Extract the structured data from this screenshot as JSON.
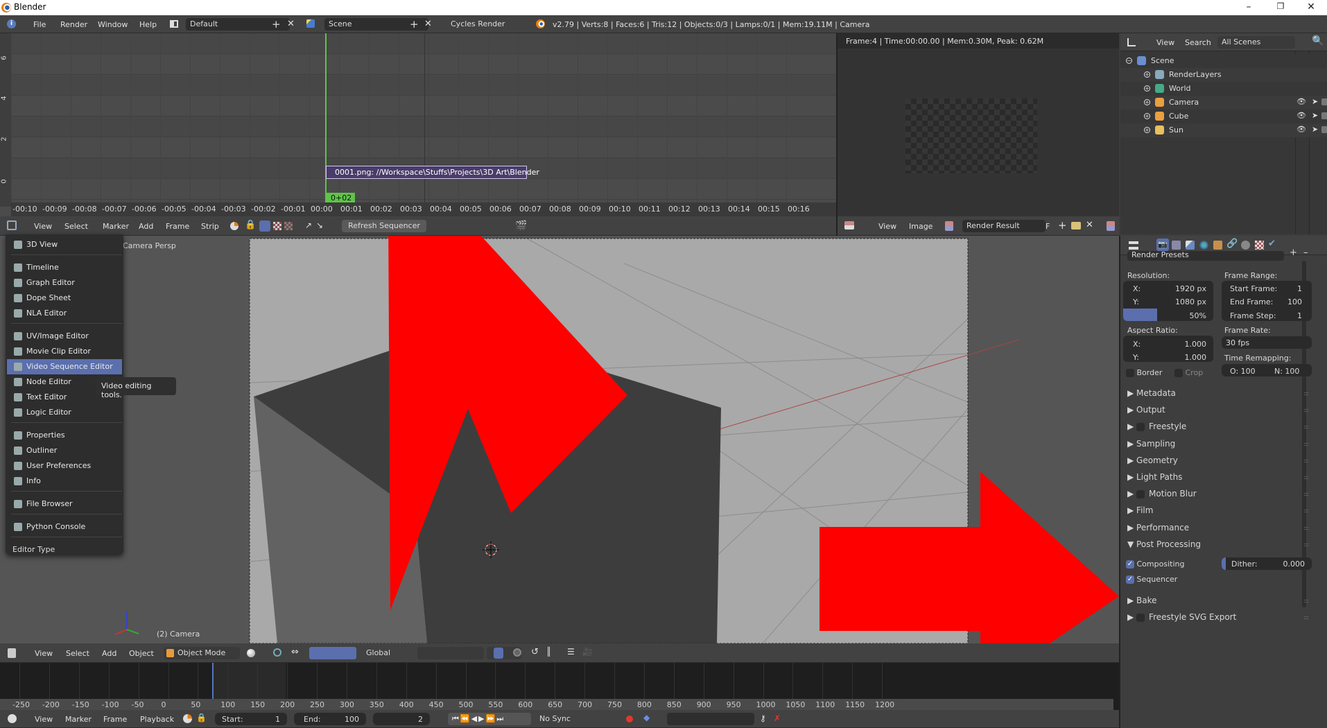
{
  "window": {
    "title": "Blender",
    "controls": [
      "minimize",
      "restore",
      "close"
    ]
  },
  "info_header": {
    "menus": [
      "File",
      "Render",
      "Window",
      "Help"
    ],
    "screen_layout": "Default",
    "scene": "Scene",
    "render_engine": "Cycles Render",
    "stats": "v2.79 | Verts:8 | Faces:6 | Tris:12 | Objects:0/3 | Lamps:0/1 | Mem:19.11M | Camera"
  },
  "sequencer": {
    "y_ticks": [
      "6",
      "4",
      "2",
      "0"
    ],
    "x_ticks": [
      "-00:10",
      "-00:09",
      "-00:08",
      "-00:07",
      "-00:06",
      "-00:05",
      "-00:04",
      "-00:03",
      "-00:02",
      "-00:01",
      "00:00",
      "00:01",
      "00:02",
      "00:03",
      "00:04",
      "00:05",
      "00:06",
      "00:07",
      "00:08",
      "00:09",
      "00:10",
      "00:11",
      "00:12",
      "00:13",
      "00:14",
      "00:15",
      "00:16"
    ],
    "strip_label": "0001.png: //Workspace\\Stuffs\\Projects\\3D Art\\Blender",
    "current_frame_label": "0+02",
    "header_menus": [
      "View",
      "Select",
      "Marker",
      "Add",
      "Frame",
      "Strip"
    ],
    "refresh_button": "Refresh Sequencer"
  },
  "image_editor": {
    "render_info": "Frame:4 | Time:00:00.00 | Mem:0.30M, Peak: 0.62M",
    "header_menus": [
      "View",
      "Image"
    ],
    "image_name": "Render Result",
    "fake_user": "F"
  },
  "outliner": {
    "header_menus": [
      "View",
      "Search"
    ],
    "display_mode": "All Scenes",
    "items": [
      {
        "label": "Scene",
        "icon": "scene-icon",
        "level": 0
      },
      {
        "label": "RenderLayers",
        "icon": "render-layers-icon",
        "level": 1
      },
      {
        "label": "World",
        "icon": "world-icon",
        "level": 1
      },
      {
        "label": "Camera",
        "icon": "camera-object-icon",
        "level": 1
      },
      {
        "label": "Cube",
        "icon": "mesh-icon",
        "level": 1
      },
      {
        "label": "Sun",
        "icon": "lamp-icon",
        "level": 1
      }
    ]
  },
  "editor_type_menu": {
    "title": "Editor Type",
    "groups": [
      [
        {
          "label": "3D View",
          "icon": "3d-view-icon"
        }
      ],
      [
        {
          "label": "Timeline",
          "icon": "timeline-icon"
        },
        {
          "label": "Graph Editor",
          "icon": "graph-editor-icon"
        },
        {
          "label": "Dope Sheet",
          "icon": "dope-sheet-icon"
        },
        {
          "label": "NLA Editor",
          "icon": "nla-editor-icon"
        }
      ],
      [
        {
          "label": "UV/Image Editor",
          "icon": "uv-image-editor-icon"
        },
        {
          "label": "Movie Clip Editor",
          "icon": "movie-clip-editor-icon"
        },
        {
          "label": "Video Sequence Editor",
          "icon": "video-sequence-editor-icon",
          "highlighted": true
        },
        {
          "label": "Node Editor",
          "icon": "node-editor-icon"
        },
        {
          "label": "Text Editor",
          "icon": "text-editor-icon"
        },
        {
          "label": "Logic Editor",
          "icon": "logic-editor-icon"
        }
      ],
      [
        {
          "label": "Properties",
          "icon": "properties-icon"
        },
        {
          "label": "Outliner",
          "icon": "outliner-icon"
        },
        {
          "label": "User Preferences",
          "icon": "user-preferences-icon"
        },
        {
          "label": "Info",
          "icon": "info-icon"
        }
      ],
      [
        {
          "label": "File Browser",
          "icon": "file-browser-icon"
        }
      ],
      [
        {
          "label": "Python Console",
          "icon": "python-console-icon"
        }
      ]
    ],
    "tooltip": "Video editing tools."
  },
  "viewport": {
    "view_label": "Camera Persp",
    "object_label": "(2) Camera",
    "header_menus": [
      "View",
      "Select",
      "Add",
      "Object"
    ],
    "mode": "Object Mode",
    "orientation": "Global"
  },
  "properties": {
    "presets": "Render Presets",
    "resolution": {
      "label": "Resolution:",
      "x_label": "X:",
      "x": "1920 px",
      "y_label": "Y:",
      "y": "1080 px",
      "percent": "50%",
      "percent_value": 0.5
    },
    "aspect": {
      "label": "Aspect Ratio:",
      "x_label": "X:",
      "x": "1.000",
      "y_label": "Y:",
      "y": "1.000"
    },
    "border": "Border",
    "crop": "Crop",
    "frame_range": {
      "label": "Frame Range:",
      "start_label": "Start Frame:",
      "start": "1",
      "end_label": "End Frame:",
      "end": "100",
      "step_label": "Frame Step:",
      "step": "1"
    },
    "frame_rate": {
      "label": "Frame Rate:",
      "value": "30 fps"
    },
    "time_remap": {
      "label": "Time Remapping:",
      "old": "O: 100",
      "new": "N: 100"
    },
    "sections": [
      {
        "label": "Metadata",
        "checkbox": false
      },
      {
        "label": "Output",
        "checkbox": false
      },
      {
        "label": "Freestyle",
        "checkbox": true
      },
      {
        "label": "Sampling",
        "checkbox": false
      },
      {
        "label": "Geometry",
        "checkbox": false
      },
      {
        "label": "Light Paths",
        "checkbox": false
      },
      {
        "label": "Motion Blur",
        "checkbox": true
      },
      {
        "label": "Film",
        "checkbox": false
      },
      {
        "label": "Performance",
        "checkbox": false
      },
      {
        "label": "Post Processing",
        "checkbox": false,
        "expanded": true
      }
    ],
    "post": {
      "compositing": "Compositing",
      "sequencer": "Sequencer",
      "dither_label": "Dither:",
      "dither": "0.000"
    },
    "sections_after": [
      {
        "label": "Bake",
        "checkbox": false
      },
      {
        "label": "Freestyle SVG Export",
        "checkbox": true
      }
    ]
  },
  "timeline": {
    "ticks": [
      "-250",
      "-200",
      "-150",
      "-100",
      "-50",
      "0",
      "50",
      "100",
      "150",
      "200",
      "250",
      "300",
      "350",
      "400",
      "450",
      "500",
      "550",
      "600",
      "650",
      "700",
      "750",
      "800",
      "850",
      "900",
      "950",
      "1000",
      "1050",
      "1100",
      "1150",
      "1200"
    ],
    "header_menus": [
      "View",
      "Marker",
      "Frame",
      "Playback"
    ],
    "start_label": "Start:",
    "start": "1",
    "end_label": "End:",
    "end": "100",
    "current": "2",
    "sync": "No Sync"
  },
  "colors": {
    "accent": "#5b6fae",
    "playhead": "#5ec448",
    "annotation": "#ff0000"
  }
}
